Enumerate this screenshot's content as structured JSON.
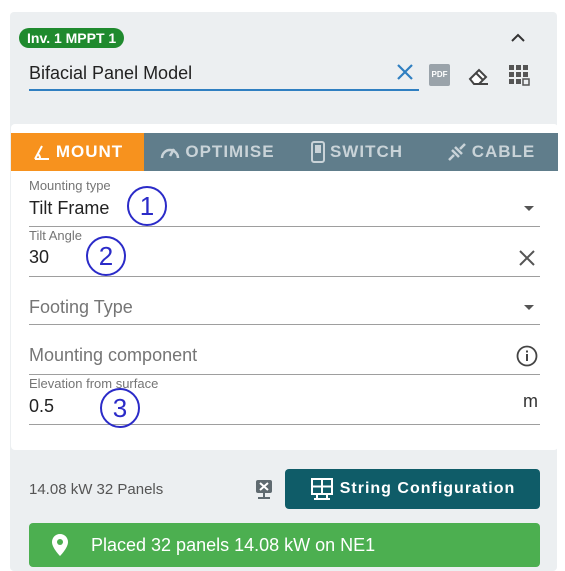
{
  "badge": {
    "label": "Inv. 1 MPPT 1"
  },
  "model": {
    "value": "Bifacial Panel Model",
    "pdf_label": "PDF"
  },
  "tabs": [
    {
      "label": "MOUNT",
      "icon": "mount-icon",
      "active": true
    },
    {
      "label": "OPTIMISE",
      "icon": "gauge-icon",
      "active": false
    },
    {
      "label": "SWITCH",
      "icon": "switch-icon",
      "active": false
    },
    {
      "label": "CABLE",
      "icon": "cable-icon",
      "active": false
    }
  ],
  "fields": {
    "mounting_type": {
      "label": "Mounting type",
      "value": "Tilt Frame"
    },
    "tilt_angle": {
      "label": "Tilt Angle",
      "value": "30"
    },
    "footing_type": {
      "placeholder": "Footing Type"
    },
    "mounting_component": {
      "placeholder": "Mounting component"
    },
    "elevation": {
      "label": "Elevation from surface",
      "value": "0.5",
      "unit": "m"
    }
  },
  "annotations": [
    "1",
    "2",
    "3"
  ],
  "summary": {
    "text": "14.08 kW 32 Panels"
  },
  "string_button": {
    "label": "String Configuration"
  },
  "placed": {
    "text": "Placed 32 panels 14.08 kW on NE1"
  },
  "colors": {
    "accent": "#f7921e",
    "tabbar": "#607d8b",
    "badge": "#1f8a2e",
    "button": "#0f5c68",
    "success": "#4caf50",
    "input_underline": "#2f7fc1"
  }
}
